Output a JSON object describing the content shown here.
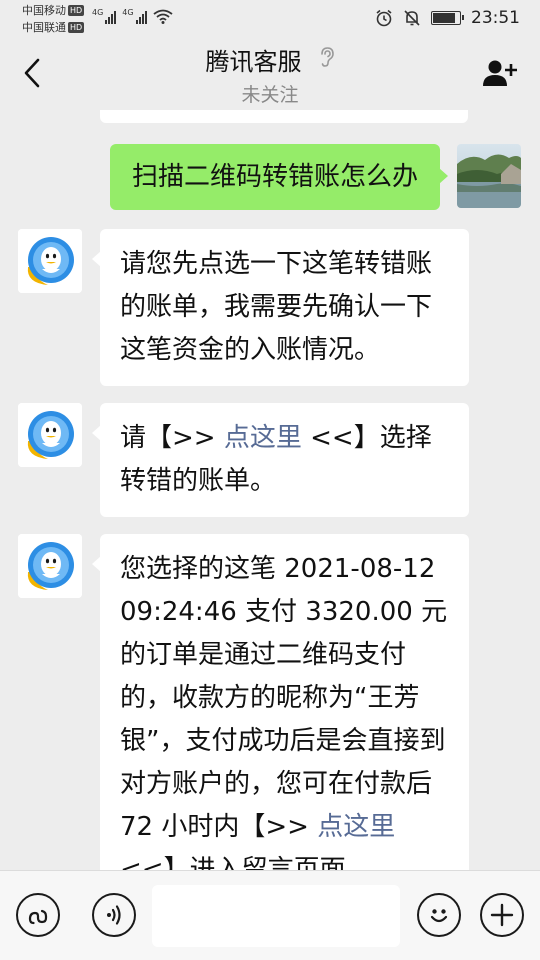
{
  "status_bar": {
    "carrier1": "中国移动",
    "carrier2": "中国联通",
    "hd": "HD",
    "network": "4G",
    "time": "23:51"
  },
  "header": {
    "title": "腾讯客服",
    "subtitle": "未关注"
  },
  "messages": {
    "user_question": "扫描二维码转错账怎么办",
    "reply1": "请您先点选一下这笔转错账的账单，我需要先确认一下这笔资金的入账情况。",
    "reply2": {
      "before": "请【>> ",
      "link": "点这里",
      "after": " <<】选择转错的账单。"
    },
    "reply3": {
      "text": "您选择的这笔 2021-08-12 09:24:46 支付 3320.00 元的订单是通过二维码支付的，收款方的昵称为“王芳银”，支付成功后是会直接到对方账户的，您可在付款后 72 小时内【>> ",
      "link": "点这里",
      "after": " <<】进入留言页面"
    }
  },
  "colors": {
    "background": "#ededed",
    "bubble_out": "#95ec69",
    "bubble_in": "#ffffff",
    "link": "#576b95"
  },
  "icons": {
    "back": "chevron-left-icon",
    "ear": "ear-icon",
    "add_friend": "add-user-icon",
    "mini_program": "mini-program-icon",
    "voice": "voice-icon",
    "emoji": "emoji-icon",
    "more": "plus-icon"
  }
}
